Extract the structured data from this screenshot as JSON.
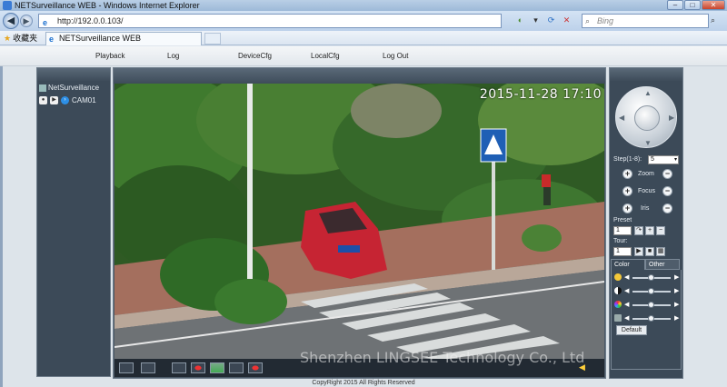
{
  "window": {
    "title": "NETSurveillance WEB - Windows Internet Explorer",
    "min": "–",
    "max": "□",
    "close": "✕"
  },
  "address": {
    "url": "http://192.0.0.103/",
    "search_placeholder": "Bing"
  },
  "favorites": {
    "label": "收藏夹",
    "tab_title": "NETSurveillance WEB"
  },
  "menu": {
    "items": [
      "Playback",
      "Log",
      "DeviceCfg",
      "LocalCfg",
      "Log Out"
    ]
  },
  "tree": {
    "root": "NetSurveillance",
    "camera": "CAM01"
  },
  "video": {
    "osd_datetime": "2015-11-28 17:10"
  },
  "ptz": {
    "step_label": "Step(1-8):",
    "step_value": "5",
    "zoom_label": "Zoom",
    "focus_label": "Focus",
    "iris_label": "Iris",
    "preset_label": "Preset",
    "preset_value": "1",
    "tour_label": "Tour:",
    "tour_value": "1"
  },
  "color_panel": {
    "tabs": [
      "Color",
      "Other"
    ],
    "default_label": "Default",
    "levels": [
      0.5,
      0.5,
      0.5,
      0.5
    ]
  },
  "footer": {
    "copyright": "CopyRight 2015 All Rights Reserved",
    "watermark": "Shenzhen LINGSEE Technology Co., Ltd"
  }
}
